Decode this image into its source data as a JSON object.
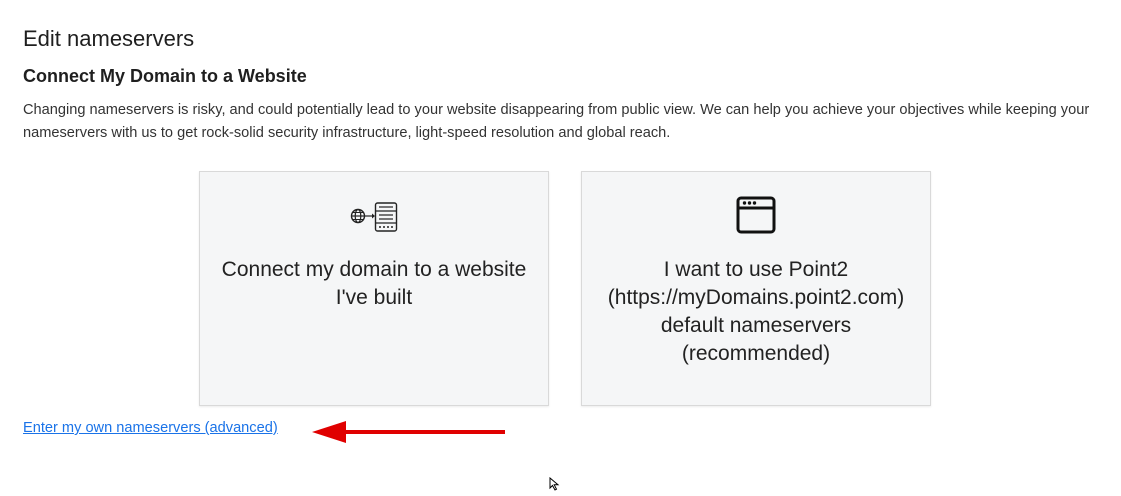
{
  "header": {
    "page_title": "Edit nameservers",
    "section_title": "Connect My Domain to a Website",
    "description": "Changing nameservers is risky, and could potentially lead to your website disappearing from public view. We can help you achieve your objectives while keeping your nameservers with us to get rock-solid security infrastructure, light-speed resolution and global reach."
  },
  "options": [
    {
      "icon": "globe-server-icon",
      "label": "Connect my domain to a website I've built"
    },
    {
      "icon": "browser-window-icon",
      "label_lines": [
        "I want to use Point2",
        "(https://myDomains.point2.com)",
        "default nameservers",
        "(recommended)"
      ]
    }
  ],
  "advanced_link": {
    "label": "Enter my own nameservers (advanced)"
  },
  "colors": {
    "link": "#1a73e8",
    "card_background": "#f5f6f7",
    "annotation_arrow": "#e00000"
  }
}
